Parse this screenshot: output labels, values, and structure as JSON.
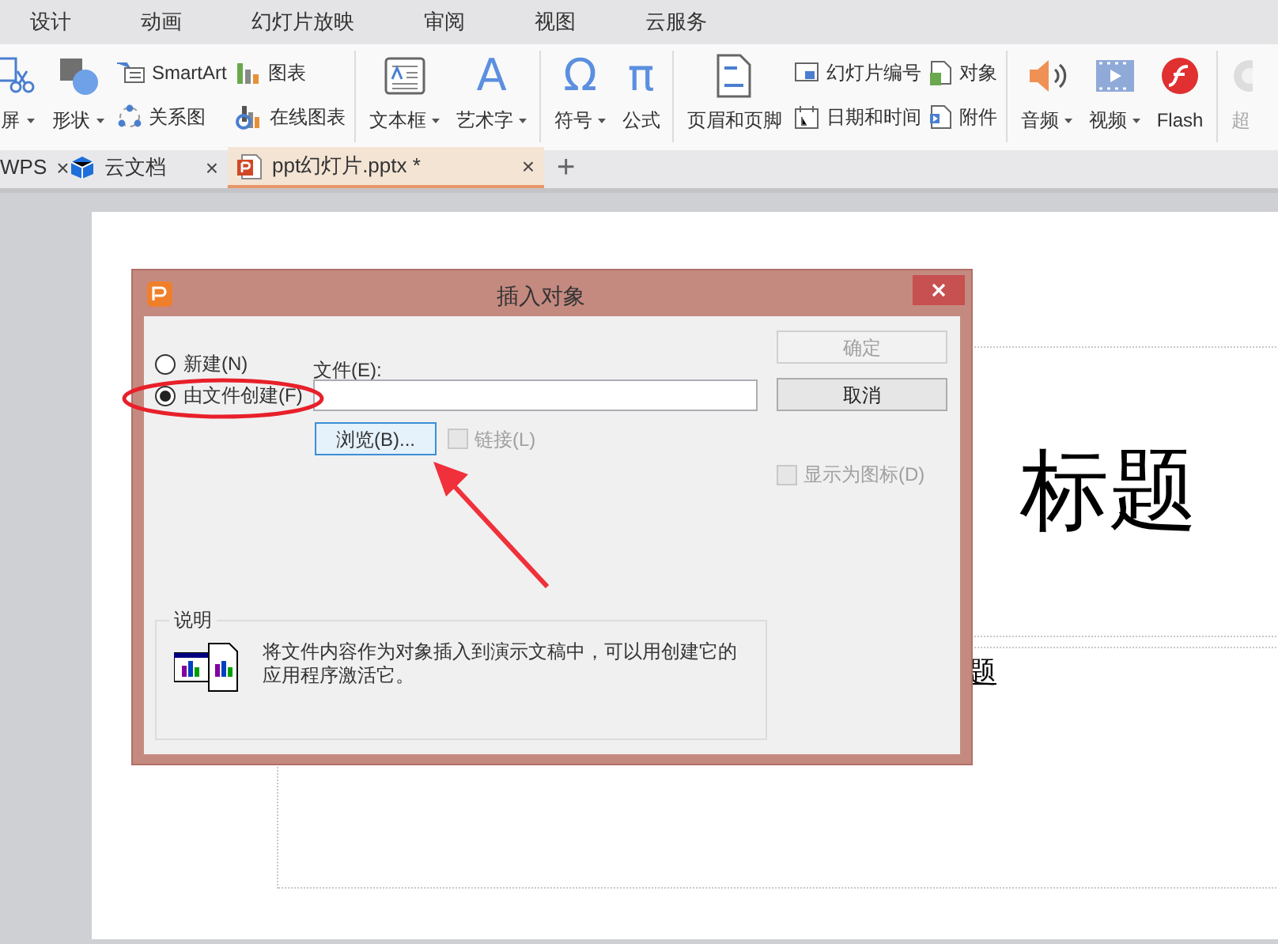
{
  "menu_tabs": [
    "设计",
    "动画",
    "幻灯片放映",
    "审阅",
    "视图",
    "云服务"
  ],
  "ribbon": {
    "groups": [
      {
        "columns": [
          {
            "kind": "large",
            "items": [
              {
                "label": "屏",
                "dropdown": true,
                "disabled": false
              }
            ]
          },
          {
            "kind": "large",
            "items": [
              {
                "label": "形状",
                "dropdown": true,
                "disabled": false
              }
            ]
          },
          {
            "kind": "pair",
            "items": [
              {
                "label": "SmartArt",
                "dropdown": false,
                "disabled": false
              },
              {
                "label": "关系图",
                "dropdown": false,
                "disabled": false
              }
            ]
          },
          {
            "kind": "pair",
            "items": [
              {
                "label": "图表",
                "dropdown": false,
                "disabled": false
              },
              {
                "label": "在线图表",
                "dropdown": false,
                "disabled": false
              }
            ]
          }
        ]
      },
      {
        "columns": [
          {
            "kind": "large",
            "items": [
              {
                "label": "文本框",
                "dropdown": true,
                "disabled": false
              }
            ]
          },
          {
            "kind": "large",
            "items": [
              {
                "label": "艺术字",
                "dropdown": true,
                "disabled": false,
                "glyph": "A"
              }
            ]
          }
        ]
      },
      {
        "columns": [
          {
            "kind": "large",
            "items": [
              {
                "label": "符号",
                "dropdown": true,
                "disabled": false,
                "glyph": "Ω"
              }
            ]
          },
          {
            "kind": "large",
            "items": [
              {
                "label": "公式",
                "dropdown": false,
                "disabled": false,
                "glyph": "π"
              }
            ]
          }
        ]
      },
      {
        "columns": [
          {
            "kind": "large",
            "items": [
              {
                "label": "页眉和页脚",
                "dropdown": false,
                "disabled": false
              }
            ]
          },
          {
            "kind": "pair",
            "items": [
              {
                "label": "幻灯片编号",
                "dropdown": false,
                "disabled": false
              },
              {
                "label": "日期和时间",
                "dropdown": false,
                "disabled": false
              }
            ]
          },
          {
            "kind": "pair",
            "items": [
              {
                "label": "对象",
                "dropdown": false,
                "disabled": false
              },
              {
                "label": "附件",
                "dropdown": false,
                "disabled": false
              }
            ]
          }
        ]
      },
      {
        "columns": [
          {
            "kind": "large",
            "items": [
              {
                "label": "音频",
                "dropdown": true,
                "disabled": false
              }
            ]
          },
          {
            "kind": "large",
            "items": [
              {
                "label": "视频",
                "dropdown": true,
                "disabled": false
              }
            ]
          },
          {
            "kind": "large",
            "items": [
              {
                "label": "Flash",
                "dropdown": false,
                "disabled": false
              }
            ]
          }
        ]
      },
      {
        "columns": [
          {
            "kind": "large",
            "items": [
              {
                "label": "超",
                "dropdown": false,
                "disabled": true
              }
            ]
          }
        ]
      }
    ]
  },
  "doc_tabs": [
    {
      "label": "WPS",
      "close": "×",
      "selected": false
    },
    {
      "label": "云文档",
      "close": "×",
      "selected": false
    },
    {
      "label": "ppt幻灯片.pptx *",
      "close": "×",
      "selected": true
    }
  ],
  "new_tab": "+",
  "slide": {
    "title": "标题",
    "subtitle": "题"
  },
  "dialog": {
    "title": "插入对象",
    "options": [
      {
        "label": "新建(N)",
        "selected": false
      },
      {
        "label": "由文件创建(F)",
        "selected": true
      }
    ],
    "file_label": "文件(E):",
    "browse_button": "浏览(B)...",
    "link_checkbox": {
      "label": "链接(L)",
      "checked": false,
      "disabled": true
    },
    "buttons": [
      {
        "label": "确定",
        "disabled": true
      },
      {
        "label": "取消",
        "disabled": false
      }
    ],
    "display_as_icon": {
      "label": "显示为图标(D)",
      "checked": false,
      "disabled": true
    },
    "description": {
      "title": "说明",
      "text": "将文件内容作为对象插入到演示文稿中，可以用创建它的应用程序激活它。"
    }
  }
}
